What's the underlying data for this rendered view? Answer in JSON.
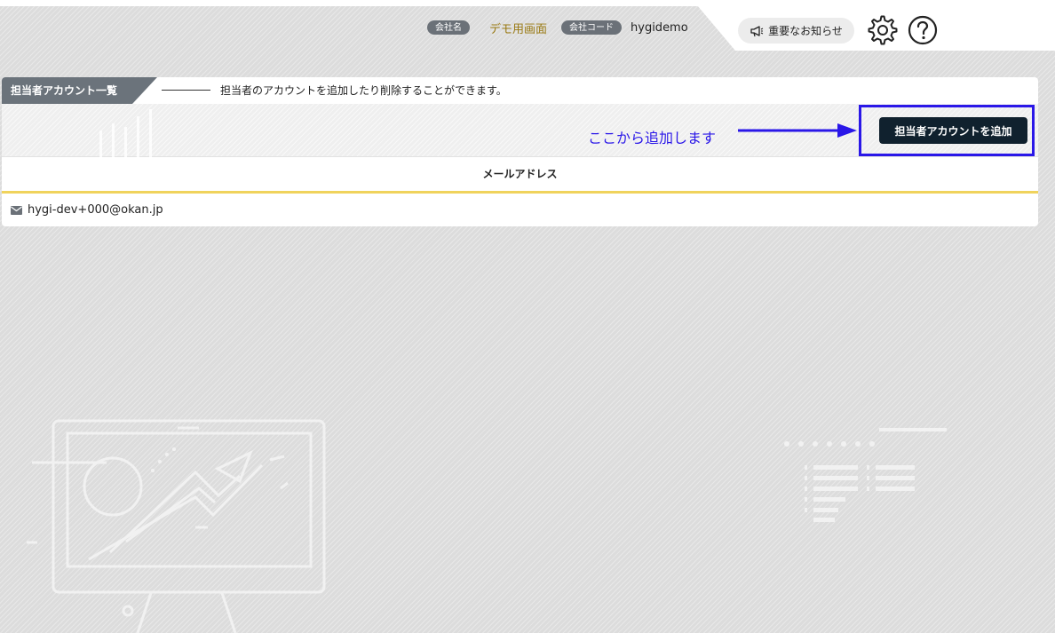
{
  "header": {
    "company_name_badge": "会社名",
    "company_name": "デモ用画面",
    "company_code_badge": "会社コード",
    "company_code": "hygidemo",
    "notice_label": "重要なお知らせ",
    "icons": [
      "megaphone-icon",
      "gear-icon",
      "help-icon"
    ]
  },
  "panel": {
    "title": "担当者アカウント一覧",
    "description": "担当者のアカウントを追加したり削除することができます。",
    "add_button_label": "担当者アカウントを追加",
    "annotation": "ここから追加します"
  },
  "table": {
    "columns": [
      "メールアドレス"
    ],
    "rows": [
      {
        "email": "hygi-dev+000@okan.jp"
      }
    ]
  },
  "colors": {
    "accent_annotation": "#2a17e8",
    "button_bg": "#10212e",
    "table_header_underline": "#f0d35c",
    "badge_bg": "#6b7178"
  }
}
